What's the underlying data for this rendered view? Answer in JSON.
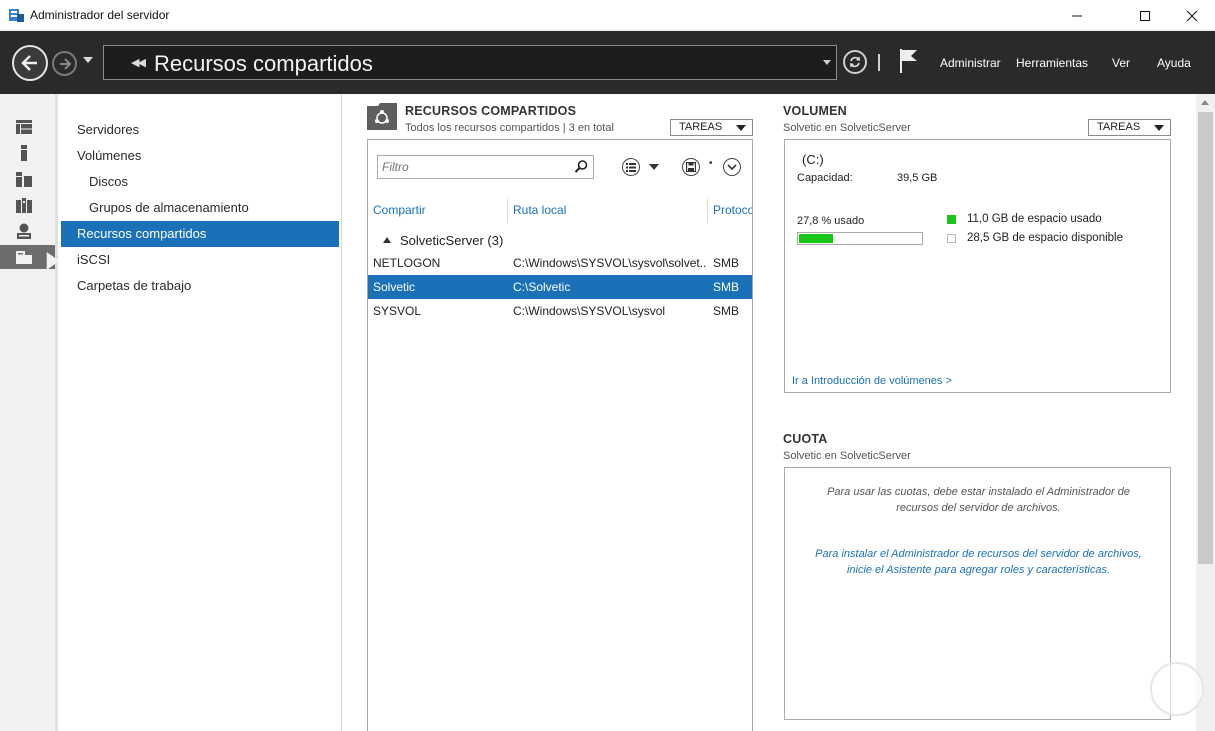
{
  "window": {
    "title": "Administrador del servidor"
  },
  "navbar": {
    "breadcrumb": "Recursos compartidos",
    "menu": [
      "Administrar",
      "Herramientas",
      "Ver",
      "Ayuda"
    ]
  },
  "subnav": {
    "items": [
      {
        "label": "Servidores",
        "indent": false,
        "selected": false
      },
      {
        "label": "Volúmenes",
        "indent": false,
        "selected": false
      },
      {
        "label": "Discos",
        "indent": true,
        "selected": false
      },
      {
        "label": "Grupos de almacenamiento",
        "indent": true,
        "selected": false
      },
      {
        "label": "Recursos compartidos",
        "indent": false,
        "selected": true
      },
      {
        "label": "iSCSI",
        "indent": false,
        "selected": false
      },
      {
        "label": "Carpetas de trabajo",
        "indent": false,
        "selected": false
      }
    ]
  },
  "shares": {
    "title": "RECURSOS COMPARTIDOS",
    "subtitle": "Todos los recursos compartidos | 3 en total",
    "tasks_label": "TAREAS",
    "filter_placeholder": "Filtro",
    "columns": [
      "Compartir",
      "Ruta local",
      "Protoco"
    ],
    "group": "SolveticServer (3)",
    "rows": [
      {
        "name": "NETLOGON",
        "path": "C:\\Windows\\SYSVOL\\sysvol\\solvet...",
        "protocol": "SMB",
        "selected": false
      },
      {
        "name": "Solvetic",
        "path": "C:\\Solvetic",
        "protocol": "SMB",
        "selected": true
      },
      {
        "name": "SYSVOL",
        "path": "C:\\Windows\\SYSVOL\\sysvol",
        "protocol": "SMB",
        "selected": false
      }
    ]
  },
  "volume": {
    "title": "VOLUMEN",
    "subtitle": "Solvetic en SolveticServer",
    "tasks_label": "TAREAS",
    "drive": "(C:)",
    "capacity_label": "Capacidad:",
    "capacity_value": "39,5 GB",
    "used_label": "27,8 % usado",
    "used_fraction": 0.278,
    "legend_used": "11,0 GB de espacio usado",
    "legend_free": "28,5 GB de espacio disponible",
    "link": "Ir a Introducción de volúmenes >",
    "colors": {
      "used": "#17c617"
    }
  },
  "quota": {
    "title": "CUOTA",
    "subtitle": "Solvetic en SolveticServer",
    "message_line1": "Para usar las cuotas, debe estar instalado el Administrador de",
    "message_line2": "recursos del servidor de archivos.",
    "link_line1": "Para instalar el Administrador de recursos del servidor de archivos,",
    "link_line2": "inicie el Asistente para agregar roles y características."
  },
  "icons": {
    "rail": [
      "dashboard-icon",
      "local-server-icon",
      "all-servers-icon",
      "file-storage-icon",
      "iis-icon",
      "shares-icon"
    ]
  }
}
